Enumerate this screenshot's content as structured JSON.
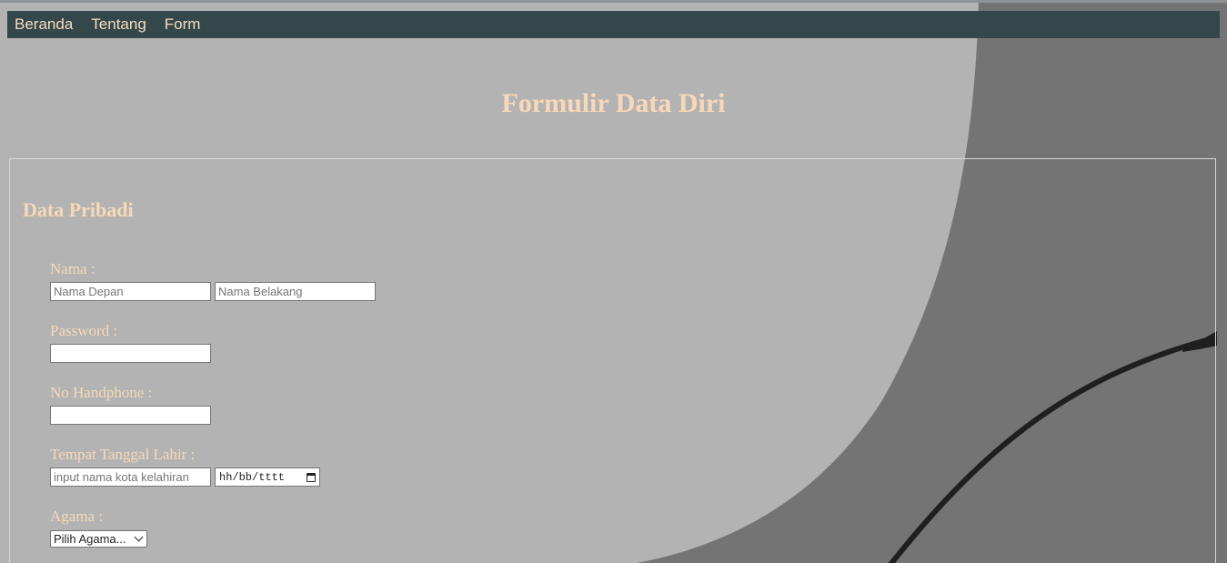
{
  "nav": {
    "items": [
      "Beranda",
      "Tentang",
      "Form"
    ]
  },
  "page": {
    "title": "Formulir Data Diri"
  },
  "form": {
    "legend": "Data Pribadi",
    "nama": {
      "label": "Nama :",
      "first_placeholder": "Nama Depan",
      "last_placeholder": "Nama Belakang"
    },
    "password": {
      "label": "Password :"
    },
    "handphone": {
      "label": "No Handphone :"
    },
    "ttl": {
      "label": "Tempat Tanggal Lahir :",
      "city_placeholder": "input nama kota kelahiran",
      "date_format": "hh/bb/tttt"
    },
    "agama": {
      "label": "Agama :",
      "selected": "Pilih Agama..."
    }
  },
  "icons": {
    "calendar": "calendar-icon",
    "dropdown": "chevron-down-icon"
  },
  "colors": {
    "navbar_bg": "#34474a",
    "nav_text": "#f3dcc0",
    "heading_text": "#f8d8b8",
    "bg_light": "#b3b3b3",
    "bg_dark": "#747474"
  }
}
